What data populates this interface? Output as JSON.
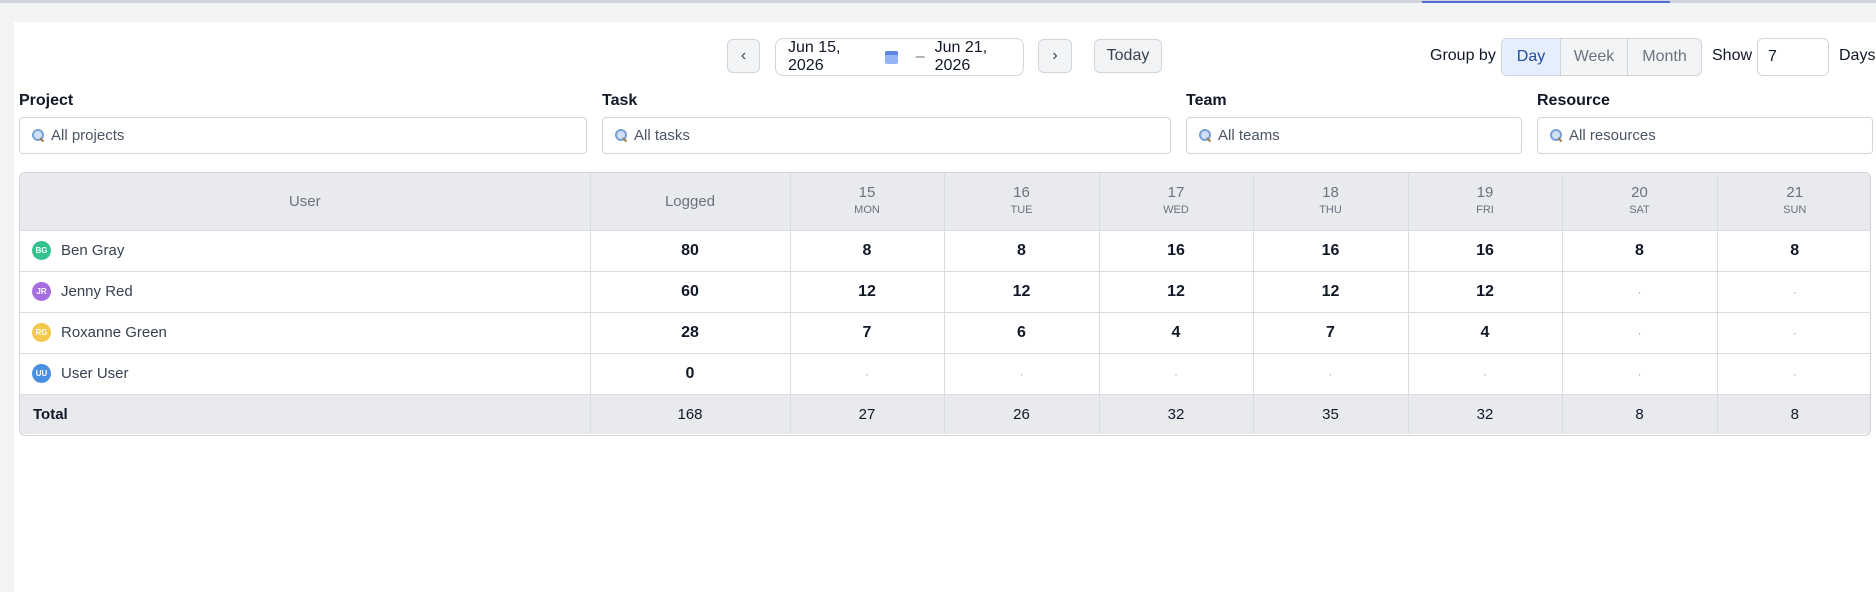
{
  "toolbar": {
    "prev_label": "‹",
    "next_label": "›",
    "start_date": "Jun 15, 2026",
    "end_date": "Jun 21, 2026",
    "date_separator": "–",
    "today_label": "Today",
    "groupby_label": "Group by",
    "groupby_options": [
      "Day",
      "Week",
      "Month"
    ],
    "groupby_selected": "Day",
    "show_label": "Show",
    "show_value": "7",
    "days_label": "Days"
  },
  "filters": {
    "project": {
      "label": "Project",
      "placeholder": "All projects"
    },
    "task": {
      "label": "Task",
      "placeholder": "All tasks"
    },
    "team": {
      "label": "Team",
      "placeholder": "All teams"
    },
    "resource": {
      "label": "Resource",
      "placeholder": "All resources"
    }
  },
  "table": {
    "user_header": "User",
    "logged_header": "Logged",
    "days": [
      {
        "num": "15",
        "name": "MON"
      },
      {
        "num": "16",
        "name": "TUE"
      },
      {
        "num": "17",
        "name": "WED"
      },
      {
        "num": "18",
        "name": "THU"
      },
      {
        "num": "19",
        "name": "FRI"
      },
      {
        "num": "20",
        "name": "SAT"
      },
      {
        "num": "21",
        "name": "SUN"
      }
    ],
    "rows": [
      {
        "initials": "BG",
        "avatar_color": "#34c38f",
        "name": "Ben Gray",
        "logged": "80",
        "values": [
          "8",
          "8",
          "16",
          "16",
          "16",
          "8",
          "8"
        ]
      },
      {
        "initials": "JR",
        "avatar_color": "#a66fe0",
        "name": "Jenny Red",
        "logged": "60",
        "values": [
          "12",
          "12",
          "12",
          "12",
          "12",
          "·",
          "·"
        ]
      },
      {
        "initials": "RG",
        "avatar_color": "#f2c94c",
        "name": "Roxanne Green",
        "logged": "28",
        "values": [
          "7",
          "6",
          "4",
          "7",
          "4",
          "·",
          "·"
        ]
      },
      {
        "initials": "UU",
        "avatar_color": "#4a90e2",
        "name": "User User",
        "logged": "0",
        "values": [
          "·",
          "·",
          "·",
          "·",
          "·",
          "·",
          "·"
        ]
      }
    ],
    "total": {
      "label": "Total",
      "logged": "168",
      "values": [
        "27",
        "26",
        "32",
        "35",
        "32",
        "8",
        "8"
      ]
    }
  }
}
